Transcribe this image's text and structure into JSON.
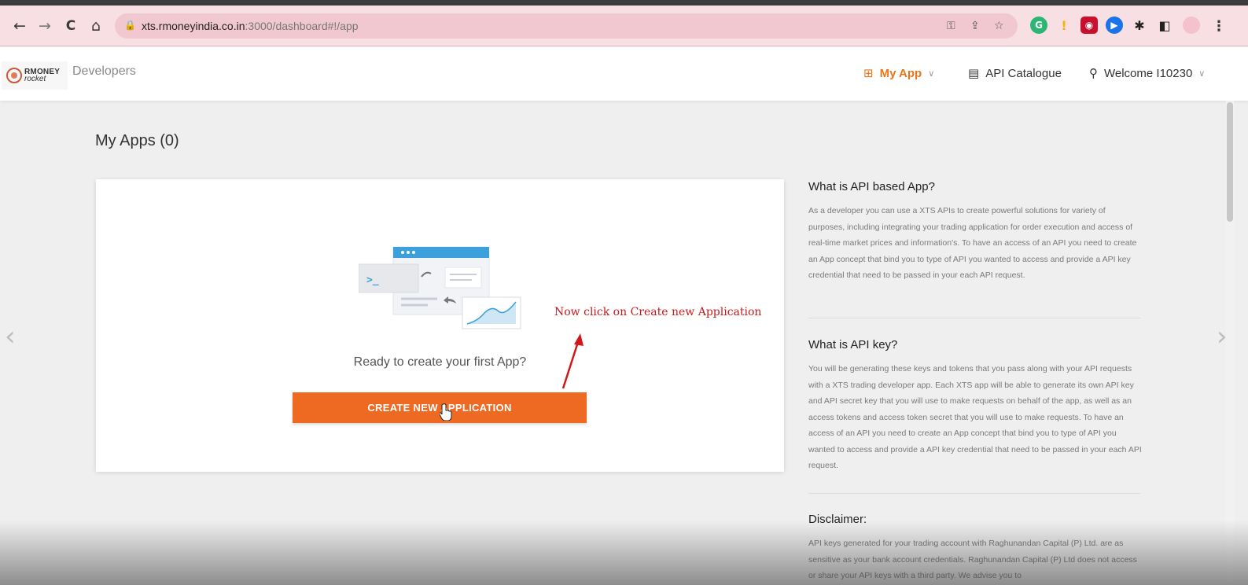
{
  "browser": {
    "back_icon": "←",
    "forward_icon": "→",
    "reload_icon": "C",
    "home_icon": "⌂",
    "url_host": "xts.rmoneyindia.co.in",
    "url_path": ":3000/dashboard#!/app",
    "menu_icon": "⋮"
  },
  "header": {
    "logo_line1": "RMONEY",
    "logo_line2": "rocket",
    "developers_label": "Developers",
    "nav": {
      "my_app": "My App",
      "api_catalogue": "API Catalogue",
      "welcome": "Welcome I10230"
    }
  },
  "main": {
    "title": "My Apps (0)",
    "ready_text": "Ready to create your first App?",
    "create_button": "CREATE NEW APPLICATION",
    "annotation": "Now click on Create new Application"
  },
  "info": {
    "section1_title": "What is API based App?",
    "section1_text": "As a developer you can use a XTS APIs to create powerful solutions for variety of purposes, including integrating your trading application for order execution and access of real-time market prices and information's. To have an access of an API you need to create an App concept that bind you to type of API you wanted to access and provide a API key credential that need to be passed in your each API request.",
    "section2_title": "What is API key?",
    "section2_text": "You will be generating these keys and tokens that you pass along with your API requests with a XTS trading developer app. Each XTS app will be able to generate its own API key and API secret key that you will use to make requests on behalf of the app, as well as an access tokens and access token secret that you will use to make requests. To have an access of an API you need to create an App concept that bind you to type of API you wanted to access and provide a API key credential that need to be passed in your each API request.",
    "section3_title": "Disclaimer:",
    "section3_text": "API keys generated for your trading account with Raghunandan Capital (P) Ltd. are as sensitive as your bank account credentials. Raghunandan Capital (P) Ltd does not access or share your API keys with a third party. We advise you to"
  },
  "colors": {
    "accent": "#ee6a23",
    "nav_active": "#e8751a",
    "annotation": "#c41a1a"
  }
}
